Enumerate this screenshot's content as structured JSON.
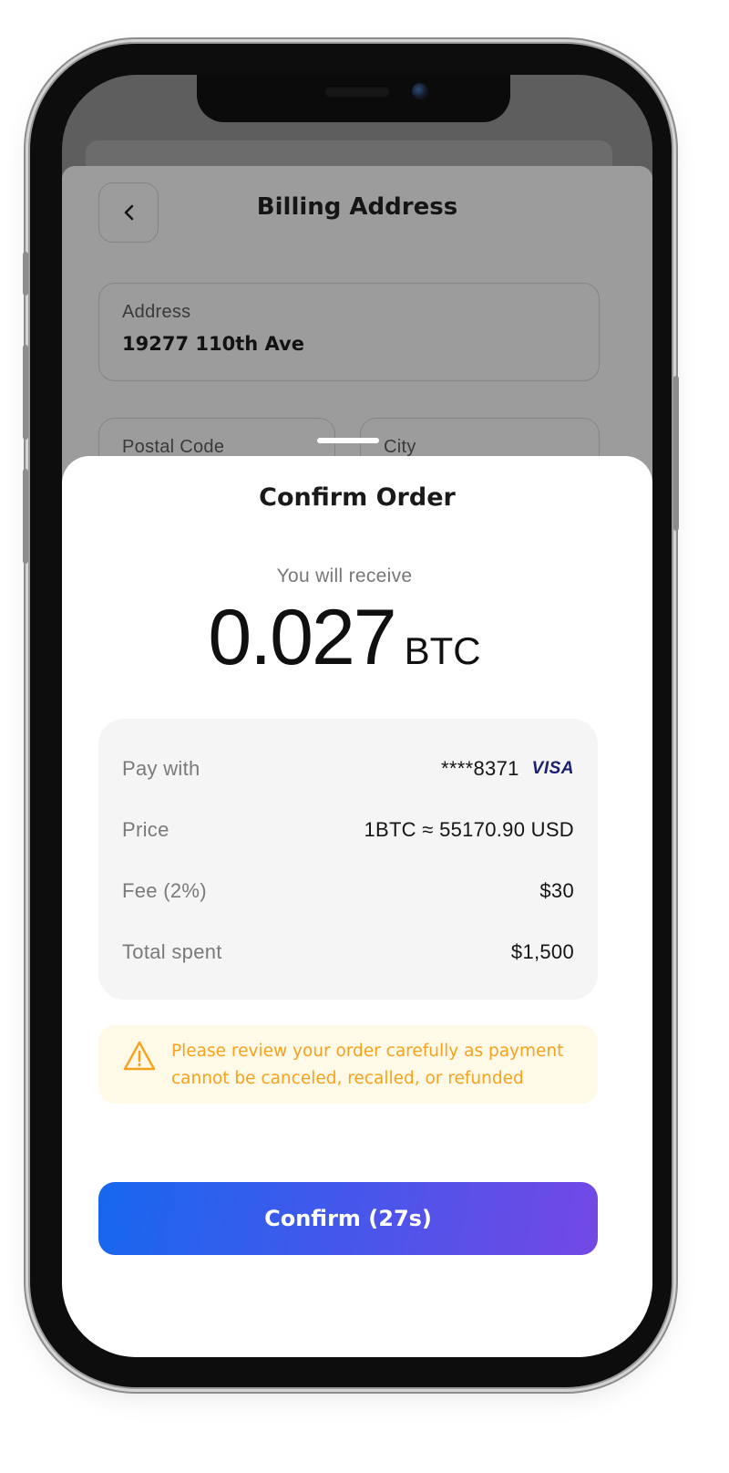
{
  "background_screen": {
    "title": "Billing Address",
    "address": {
      "label": "Address",
      "value": "19277 110th Ave"
    },
    "postal_code": {
      "label": "Postal Code"
    },
    "city": {
      "label": "City"
    }
  },
  "sheet": {
    "title": "Confirm Order",
    "receive_label": "You will receive",
    "amount": "0.027",
    "unit": "BTC",
    "details": [
      {
        "label": "Pay with",
        "value": "****8371",
        "brand": "VISA"
      },
      {
        "label": "Price",
        "value": "1BTC ≈ 55170.90 USD"
      },
      {
        "label": "Fee (2%)",
        "value": "$30"
      },
      {
        "label": "Total spent",
        "value": "$1,500"
      }
    ],
    "warning": "Please review your order carefully as payment cannot be canceled, recalled, or refunded",
    "confirm_button": "Confirm (27s)"
  },
  "colors": {
    "accent_start": "#1767ef",
    "accent_end": "#7448e5",
    "warning_text": "#f6a21a",
    "warning_bg": "#fff9e8",
    "visa": "#1a1f71"
  },
  "icons": [
    "chevron-left-icon",
    "warning-triangle-icon",
    "visa-logo"
  ]
}
